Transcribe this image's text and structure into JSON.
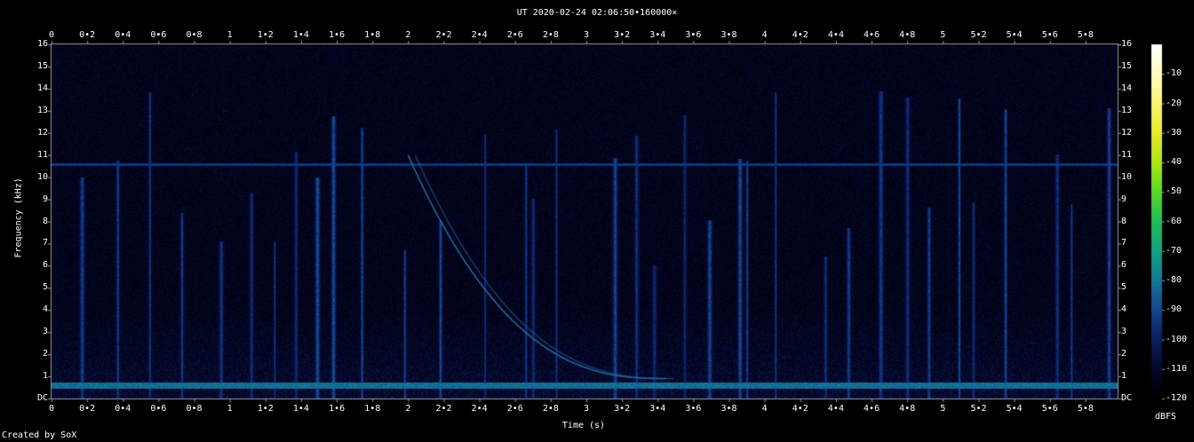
{
  "chart_data": {
    "type": "heatmap",
    "title": "UT 2020-02-24 02:06:50•160000×",
    "xlabel": "Time (s)",
    "ylabel": "Frequency (kHz)",
    "xlim": [
      0,
      5.98
    ],
    "ylim": [
      0,
      16
    ],
    "x_ticks": [
      "0",
      "0•2",
      "0•4",
      "0•6",
      "0•8",
      "1",
      "1•2",
      "1•4",
      "1•6",
      "1•8",
      "2",
      "2•2",
      "2•4",
      "2•6",
      "2•8",
      "3",
      "3•2",
      "3•4",
      "3•6",
      "3•8",
      "4",
      "4•2",
      "4•4",
      "4•6",
      "4•8",
      "5",
      "5•2",
      "5•4",
      "5•6",
      "5•8"
    ],
    "y_ticks": [
      "DC",
      "1",
      "2",
      "3",
      "4",
      "5",
      "6",
      "7",
      "8",
      "9",
      "10",
      "11",
      "12",
      "13",
      "14",
      "15",
      "16"
    ],
    "colorbar": {
      "label": "dBFS",
      "ticks": [
        "-10",
        "-20",
        "-30",
        "-40",
        "-50",
        "-60",
        "-70",
        "-80",
        "-90",
        "-100",
        "-110",
        "-120"
      ],
      "range": [
        -120,
        0
      ]
    },
    "features": {
      "noise_floor_dbfs": -110,
      "horizontal_lines_khz": [
        10.6,
        0.6
      ],
      "sferics_time_s": [
        0.17,
        0.37,
        0.55,
        0.73,
        0.95,
        1.12,
        1.25,
        1.37,
        1.49,
        1.58,
        1.74,
        1.98,
        2.18,
        2.43,
        2.66,
        2.7,
        2.83,
        3.16,
        3.28,
        3.38,
        3.55,
        3.69,
        3.86,
        3.9,
        4.06,
        4.34,
        4.47,
        4.65,
        4.8,
        4.92,
        5.09,
        5.17,
        5.35,
        5.64,
        5.72,
        5.93
      ],
      "whistler": {
        "start_time_s": 2.0,
        "start_freq_khz": 11.0,
        "end_time_s": 3.45,
        "end_freq_khz": 0.9
      }
    },
    "footer": "Created by SoX"
  },
  "colors": {
    "background": "#000000",
    "text": "#ffffff",
    "axis": "#9a9a9a"
  }
}
